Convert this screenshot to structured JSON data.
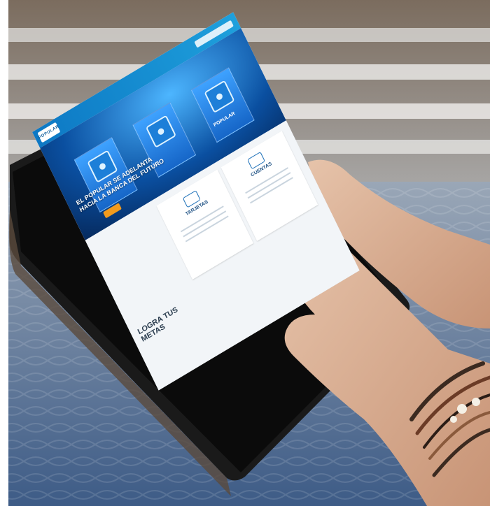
{
  "screen": {
    "brand": "POPULAR",
    "hero_title": "EL POPULAR SE ADELANTA HACIA LA BANCA DEL FUTURO",
    "card_1_title": "TARJETAS",
    "card_2_title": "CUENTAS",
    "section_title": "LOGRA TUS METAS",
    "panel_label": "POPULAR"
  },
  "colors": {
    "accent": "#1ea0dc",
    "hero": "#0a4fa0",
    "button": "#f29b1d"
  }
}
